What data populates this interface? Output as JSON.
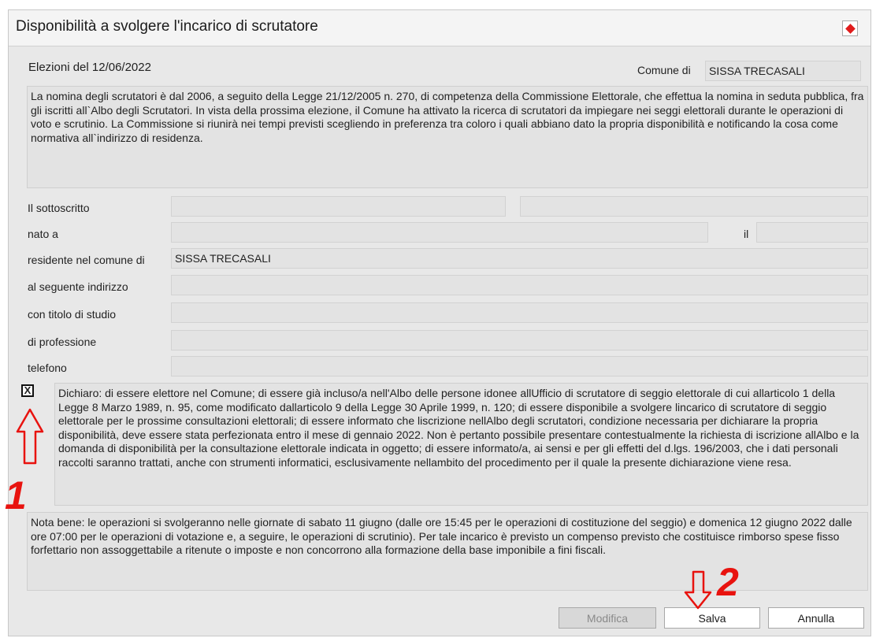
{
  "dialog": {
    "title": "Disponibilità a svolgere l'incarico di scrutatore"
  },
  "header": {
    "election_label": "Elezioni del 12/06/2022",
    "comune_label": "Comune di",
    "comune_value": "SISSA TRECASALI"
  },
  "intro_text": "La nomina degli scrutatori è dal 2006, a seguito della Legge 21/12/2005 n. 270, di competenza della Commissione Elettorale, che effettua la nomina in seduta pubblica, fra gli iscritti all`Albo degli Scrutatori. In vista della prossima elezione, il Comune ha attivato la ricerca di scrutatori da impiegare nei seggi elettorali durante le operazioni di voto e scrutinio. La Commissione si riunirà nei tempi previsti scegliendo in preferenza tra coloro i quali abbiano dato la propria disponibilità e notificando la cosa come normativa all`indirizzo di residenza.",
  "form": {
    "sottoscritto_label": "Il sottoscritto",
    "sottoscritto_value1": "",
    "sottoscritto_value2": "",
    "nato_label": "nato a",
    "nato_value": "",
    "il_label": "il",
    "il_value": "",
    "residente_label": "residente nel comune di",
    "residente_value": "SISSA TRECASALI",
    "indirizzo_label": "al seguente indirizzo",
    "indirizzo_value": "",
    "titolo_label": "con titolo di studio",
    "titolo_value": "",
    "professione_label": "di professione",
    "professione_value": "",
    "telefono_label": "telefono",
    "telefono_value": ""
  },
  "declaration": {
    "checkbox_mark": "X",
    "checked": true,
    "text": "Dichiaro: di essere elettore nel Comune; di essere già incluso/a nell'Albo delle persone idonee allUfficio di scrutatore di seggio elettorale di cui allarticolo 1 della Legge 8 Marzo 1989, n. 95, come modificato dallarticolo 9 della Legge 30 Aprile 1999, n. 120; di essere disponibile a svolgere lincarico di scrutatore di seggio elettorale per le prossime consultazioni elettorali; di essere informato che liscrizione nellAlbo degli scrutatori, condizione necessaria per dichiarare la propria disponibilità, deve essere stata perfezionata entro il mese di gennaio 2022. Non è pertanto possibile presentare contestualmente la richiesta di iscrizione allAlbo e la domanda di disponibilità per la consultazione elettorale indicata in oggetto; di essere informato/a, ai sensi e per gli effetti del d.lgs. 196/2003, che i dati personali raccolti saranno trattati, anche con strumenti informatici, esclusivamente nellambito del procedimento per il quale la presente dichiarazione viene resa."
  },
  "note_text": "Nota bene: le operazioni si svolgeranno nelle giornate di sabato 11 giugno (dalle ore 15:45 per le operazioni di costituzione del seggio) e domenica 12 giugno 2022 dalle ore 07:00 per le operazioni di votazione  e, a seguire, le operazioni di scrutinio). Per tale incarico è previsto un compenso previsto che costituisce rimborso spese fisso forfettario non assoggettabile a ritenute o imposte e non concorrono alla formazione della base imponibile a fini fiscali.",
  "buttons": {
    "modifica": "Modifica",
    "salva": "Salva",
    "annulla": "Annulla"
  },
  "annotations": {
    "step1": "1",
    "step2": "2",
    "color": "#e8130f"
  }
}
